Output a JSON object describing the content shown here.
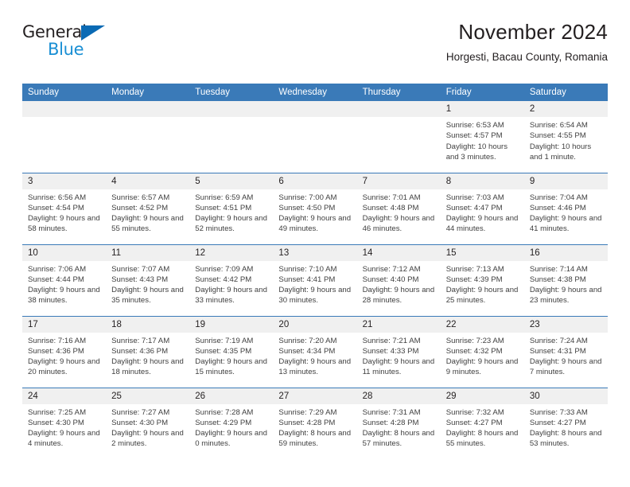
{
  "brand": {
    "name_part1": "General",
    "name_part2": "Blue",
    "logo_icon": "triangle-logo-icon"
  },
  "header": {
    "title": "November 2024",
    "subtitle": "Horgesti, Bacau County, Romania"
  },
  "colors": {
    "header_blue": "#3a7ab8",
    "brand_dark": "#231f20",
    "brand_blue": "#1a8fd4",
    "daynum_band": "#f0f0f0"
  },
  "weekday_headers": [
    "Sunday",
    "Monday",
    "Tuesday",
    "Wednesday",
    "Thursday",
    "Friday",
    "Saturday"
  ],
  "weeks": [
    [
      {
        "day": "",
        "empty": true
      },
      {
        "day": "",
        "empty": true
      },
      {
        "day": "",
        "empty": true
      },
      {
        "day": "",
        "empty": true
      },
      {
        "day": "",
        "empty": true
      },
      {
        "day": "1",
        "sunrise": "Sunrise: 6:53 AM",
        "sunset": "Sunset: 4:57 PM",
        "daylight": "Daylight: 10 hours and 3 minutes."
      },
      {
        "day": "2",
        "sunrise": "Sunrise: 6:54 AM",
        "sunset": "Sunset: 4:55 PM",
        "daylight": "Daylight: 10 hours and 1 minute."
      }
    ],
    [
      {
        "day": "3",
        "sunrise": "Sunrise: 6:56 AM",
        "sunset": "Sunset: 4:54 PM",
        "daylight": "Daylight: 9 hours and 58 minutes."
      },
      {
        "day": "4",
        "sunrise": "Sunrise: 6:57 AM",
        "sunset": "Sunset: 4:52 PM",
        "daylight": "Daylight: 9 hours and 55 minutes."
      },
      {
        "day": "5",
        "sunrise": "Sunrise: 6:59 AM",
        "sunset": "Sunset: 4:51 PM",
        "daylight": "Daylight: 9 hours and 52 minutes."
      },
      {
        "day": "6",
        "sunrise": "Sunrise: 7:00 AM",
        "sunset": "Sunset: 4:50 PM",
        "daylight": "Daylight: 9 hours and 49 minutes."
      },
      {
        "day": "7",
        "sunrise": "Sunrise: 7:01 AM",
        "sunset": "Sunset: 4:48 PM",
        "daylight": "Daylight: 9 hours and 46 minutes."
      },
      {
        "day": "8",
        "sunrise": "Sunrise: 7:03 AM",
        "sunset": "Sunset: 4:47 PM",
        "daylight": "Daylight: 9 hours and 44 minutes."
      },
      {
        "day": "9",
        "sunrise": "Sunrise: 7:04 AM",
        "sunset": "Sunset: 4:46 PM",
        "daylight": "Daylight: 9 hours and 41 minutes."
      }
    ],
    [
      {
        "day": "10",
        "sunrise": "Sunrise: 7:06 AM",
        "sunset": "Sunset: 4:44 PM",
        "daylight": "Daylight: 9 hours and 38 minutes."
      },
      {
        "day": "11",
        "sunrise": "Sunrise: 7:07 AM",
        "sunset": "Sunset: 4:43 PM",
        "daylight": "Daylight: 9 hours and 35 minutes."
      },
      {
        "day": "12",
        "sunrise": "Sunrise: 7:09 AM",
        "sunset": "Sunset: 4:42 PM",
        "daylight": "Daylight: 9 hours and 33 minutes."
      },
      {
        "day": "13",
        "sunrise": "Sunrise: 7:10 AM",
        "sunset": "Sunset: 4:41 PM",
        "daylight": "Daylight: 9 hours and 30 minutes."
      },
      {
        "day": "14",
        "sunrise": "Sunrise: 7:12 AM",
        "sunset": "Sunset: 4:40 PM",
        "daylight": "Daylight: 9 hours and 28 minutes."
      },
      {
        "day": "15",
        "sunrise": "Sunrise: 7:13 AM",
        "sunset": "Sunset: 4:39 PM",
        "daylight": "Daylight: 9 hours and 25 minutes."
      },
      {
        "day": "16",
        "sunrise": "Sunrise: 7:14 AM",
        "sunset": "Sunset: 4:38 PM",
        "daylight": "Daylight: 9 hours and 23 minutes."
      }
    ],
    [
      {
        "day": "17",
        "sunrise": "Sunrise: 7:16 AM",
        "sunset": "Sunset: 4:36 PM",
        "daylight": "Daylight: 9 hours and 20 minutes."
      },
      {
        "day": "18",
        "sunrise": "Sunrise: 7:17 AM",
        "sunset": "Sunset: 4:36 PM",
        "daylight": "Daylight: 9 hours and 18 minutes."
      },
      {
        "day": "19",
        "sunrise": "Sunrise: 7:19 AM",
        "sunset": "Sunset: 4:35 PM",
        "daylight": "Daylight: 9 hours and 15 minutes."
      },
      {
        "day": "20",
        "sunrise": "Sunrise: 7:20 AM",
        "sunset": "Sunset: 4:34 PM",
        "daylight": "Daylight: 9 hours and 13 minutes."
      },
      {
        "day": "21",
        "sunrise": "Sunrise: 7:21 AM",
        "sunset": "Sunset: 4:33 PM",
        "daylight": "Daylight: 9 hours and 11 minutes."
      },
      {
        "day": "22",
        "sunrise": "Sunrise: 7:23 AM",
        "sunset": "Sunset: 4:32 PM",
        "daylight": "Daylight: 9 hours and 9 minutes."
      },
      {
        "day": "23",
        "sunrise": "Sunrise: 7:24 AM",
        "sunset": "Sunset: 4:31 PM",
        "daylight": "Daylight: 9 hours and 7 minutes."
      }
    ],
    [
      {
        "day": "24",
        "sunrise": "Sunrise: 7:25 AM",
        "sunset": "Sunset: 4:30 PM",
        "daylight": "Daylight: 9 hours and 4 minutes."
      },
      {
        "day": "25",
        "sunrise": "Sunrise: 7:27 AM",
        "sunset": "Sunset: 4:30 PM",
        "daylight": "Daylight: 9 hours and 2 minutes."
      },
      {
        "day": "26",
        "sunrise": "Sunrise: 7:28 AM",
        "sunset": "Sunset: 4:29 PM",
        "daylight": "Daylight: 9 hours and 0 minutes."
      },
      {
        "day": "27",
        "sunrise": "Sunrise: 7:29 AM",
        "sunset": "Sunset: 4:28 PM",
        "daylight": "Daylight: 8 hours and 59 minutes."
      },
      {
        "day": "28",
        "sunrise": "Sunrise: 7:31 AM",
        "sunset": "Sunset: 4:28 PM",
        "daylight": "Daylight: 8 hours and 57 minutes."
      },
      {
        "day": "29",
        "sunrise": "Sunrise: 7:32 AM",
        "sunset": "Sunset: 4:27 PM",
        "daylight": "Daylight: 8 hours and 55 minutes."
      },
      {
        "day": "30",
        "sunrise": "Sunrise: 7:33 AM",
        "sunset": "Sunset: 4:27 PM",
        "daylight": "Daylight: 8 hours and 53 minutes."
      }
    ]
  ]
}
